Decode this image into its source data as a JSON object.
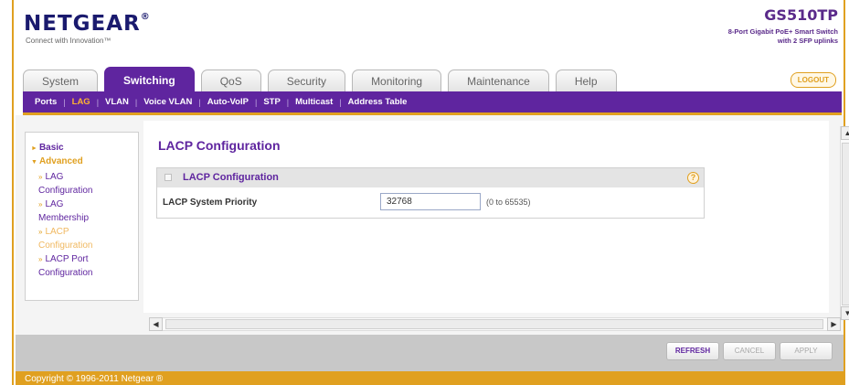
{
  "brand": {
    "name": "NETGEAR",
    "mark": "®",
    "tagline": "Connect with Innovation™"
  },
  "product": {
    "model": "GS510TP",
    "desc_lines": [
      "8-Port Gigabit PoE+ Smart Switch",
      "with 2 SFP uplinks"
    ]
  },
  "tabs": [
    {
      "label": "System"
    },
    {
      "label": "Switching"
    },
    {
      "label": "QoS"
    },
    {
      "label": "Security"
    },
    {
      "label": "Monitoring"
    },
    {
      "label": "Maintenance"
    },
    {
      "label": "Help"
    }
  ],
  "active_tab": "Switching",
  "logout_label": "LOGOUT",
  "subnav": [
    {
      "label": "Ports"
    },
    {
      "label": "LAG"
    },
    {
      "label": "VLAN"
    },
    {
      "label": "Voice VLAN"
    },
    {
      "label": "Auto-VoIP"
    },
    {
      "label": "STP"
    },
    {
      "label": "Multicast"
    },
    {
      "label": "Address Table"
    }
  ],
  "active_subnav": "LAG",
  "sidebar": {
    "basic": "Basic",
    "advanced": "Advanced",
    "items": [
      {
        "lines": [
          "LAG",
          "Configuration"
        ]
      },
      {
        "lines": [
          "LAG",
          "Membership"
        ]
      },
      {
        "lines": [
          "LACP",
          "Configuration"
        ]
      },
      {
        "lines": [
          "LACP Port",
          "Configuration"
        ]
      }
    ],
    "active_index": 2
  },
  "page": {
    "title": "LACP Configuration"
  },
  "panel": {
    "title": "LACP Configuration",
    "help_glyph": "?",
    "field_label": "LACP System Priority",
    "field_value": "32768",
    "field_hint": "(0 to 65535)"
  },
  "scroll": {
    "up": "▲",
    "down": "▼",
    "left": "◀",
    "right": "▶"
  },
  "actions": {
    "refresh": "REFRESH",
    "cancel": "CANCEL",
    "apply": "APPLY"
  },
  "footer": {
    "copyright": "Copyright © 1996-2011 Netgear ®"
  },
  "colors": {
    "primary": "#5f259f",
    "accent": "#e0a020",
    "panel_bg": "#e4e4e4"
  }
}
